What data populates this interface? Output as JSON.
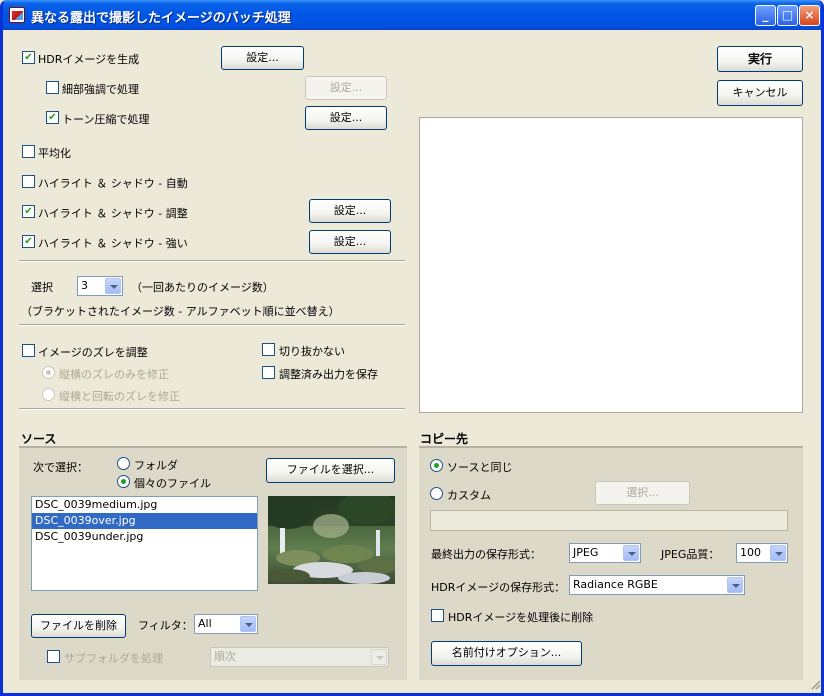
{
  "window": {
    "title": "異なる露出で撮影したイメージのバッチ処理"
  },
  "titlebar_buttons": {
    "minimize": "_",
    "maximize": "□",
    "close": "×"
  },
  "options": {
    "hdr_generate": {
      "label": "HDRイメージを生成",
      "checked": true,
      "settings_label": "設定..."
    },
    "detail_enhance": {
      "label": "細部強調で処理",
      "checked": false,
      "settings_label": "設定..."
    },
    "tone_compress": {
      "label": "トーン圧縮で処理",
      "checked": true,
      "settings_label": "設定..."
    },
    "average": {
      "label": "平均化",
      "checked": false
    },
    "hs_auto": {
      "label": "ハイライト ＆ シャドウ - 自動",
      "checked": false
    },
    "hs_adjust": {
      "label": "ハイライト ＆ シャドウ - 調整",
      "checked": true,
      "settings_label": "設定..."
    },
    "hs_strong": {
      "label": "ハイライト ＆ シャドウ - 強い",
      "checked": true,
      "settings_label": "設定..."
    }
  },
  "select_count": {
    "label": "選択",
    "value": "3",
    "suffix": "（一回あたりのイメージ数）",
    "note": "（ブラケットされたイメージ数 - アルファベット順に並べ替え）"
  },
  "align": {
    "label": "イメージのズレを調整",
    "opt_translate": "縦横のズレのみを修正",
    "opt_rotate": "縦横と回転のズレを修正",
    "no_crop": "切り抜かない",
    "save_adjusted": "調整済み出力を保存"
  },
  "actions": {
    "run": "実行",
    "cancel": "キャンセル"
  },
  "source": {
    "title": "ソース",
    "select_by": "次で選択：",
    "opt_folder": "フォルダ",
    "opt_files": "個々のファイル",
    "choose_files": "ファイルを選択...",
    "files": [
      "DSC_0039medium.jpg",
      "DSC_0039over.jpg",
      "DSC_0039under.jpg"
    ],
    "selected_index": 1,
    "delete_file": "ファイルを削除",
    "filter_label": "フィルタ：",
    "filter_value": "All",
    "subfolder": "サブフォルダを処理",
    "order_value": "順次"
  },
  "destination": {
    "title": "コピー先",
    "same_as_source": "ソースと同じ",
    "custom": "カスタム",
    "choose": "選択...",
    "path_value": "",
    "output_format_label": "最終出力の保存形式：",
    "output_format_value": "JPEG",
    "jpeg_quality_label": "JPEG品質：",
    "jpeg_quality_value": "100",
    "hdr_format_label": "HDRイメージの保存形式：",
    "hdr_format_value": "Radiance RGBE",
    "delete_hdr": "HDRイメージを処理後に削除",
    "naming_options": "名前付けオプション..."
  },
  "colors": {
    "titlebar": "#0055e5",
    "selection": "#316ac5",
    "window_bg": "#ece9d8",
    "panel_bg": "#ddd9c8"
  }
}
